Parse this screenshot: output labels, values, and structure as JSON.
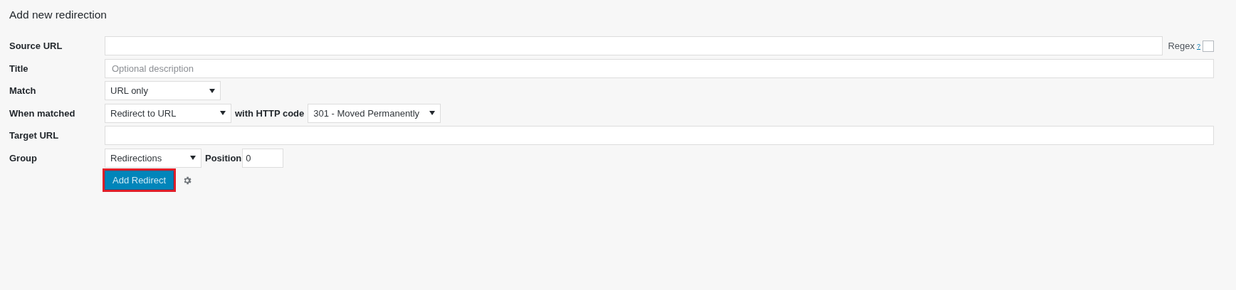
{
  "heading": "Add new redirection",
  "rows": [
    {
      "kind": "input",
      "label": "Source URL",
      "regex": {
        "label": "Regex",
        "help": "?",
        "checked": false
      }
    },
    {
      "kind": "input",
      "label": "Title",
      "placeholder": "Optional description"
    },
    {
      "kind": "select",
      "label": "Match",
      "value": "URL only"
    },
    {
      "kind": "select",
      "label": "When matched",
      "value": "Redirect to URL",
      "extra_label": "with HTTP code",
      "extra_value": "301 - Moved Permanently"
    },
    {
      "kind": "input",
      "label": "Target URL"
    },
    {
      "kind": "group",
      "label": "Group",
      "value": "Redirections",
      "extra_label": "Position",
      "extra_value": "0"
    }
  ],
  "submit": {
    "label": "Add Redirect",
    "highlighted": true
  }
}
